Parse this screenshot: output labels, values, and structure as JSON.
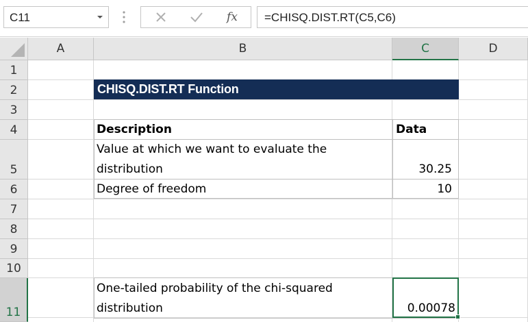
{
  "formula_bar": {
    "name_box": "C11",
    "cancel_icon": "close-icon",
    "enter_icon": "checkmark-icon",
    "function_label": "fx",
    "formula": "=CHISQ.DIST.RT(C5,C6)"
  },
  "columns": [
    "A",
    "B",
    "C",
    "D"
  ],
  "selected_column": "C",
  "rows": [
    "1",
    "2",
    "3",
    "4",
    "5",
    "6",
    "7",
    "8",
    "9",
    "10",
    "11"
  ],
  "selected_row": "11",
  "sheet": {
    "title": "CHISQ.DIST.RT  Function",
    "header_description": "Description",
    "header_data": "Data",
    "row5_description_line1": "Value at which we want to evaluate the",
    "row5_description_line2": "distribution",
    "row5_value": "30.25",
    "row6_description": "Degree of freedom",
    "row6_value": "10",
    "row11_description_line1": "One-tailed probability of the chi-squared",
    "row11_description_line2": "distribution",
    "row11_value": "0.00078"
  },
  "colors": {
    "title_fill": "#142d55",
    "selection": "#217346"
  }
}
